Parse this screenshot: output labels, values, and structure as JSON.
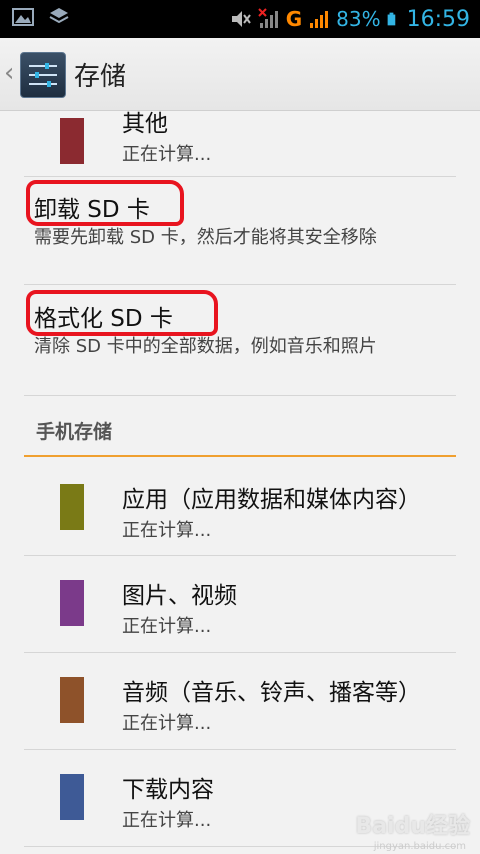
{
  "statusbar": {
    "network": "G",
    "battery": "83%",
    "time": "16:59"
  },
  "actionbar": {
    "title": "存储"
  },
  "sd_items": {
    "other": {
      "title": "其他",
      "status": "正在计算...",
      "color": "#8b2a30"
    },
    "unmount": {
      "title": "卸载 SD 卡",
      "desc": "需要先卸载 SD 卡，然后才能将其安全移除"
    },
    "format": {
      "title": "格式化 SD 卡",
      "desc": "清除 SD 卡中的全部数据，例如音乐和照片"
    }
  },
  "phone_storage": {
    "header": "手机存储",
    "items": [
      {
        "title": "应用（应用数据和媒体内容）",
        "status": "正在计算...",
        "color": "#7a7a16"
      },
      {
        "title": "图片、视频",
        "status": "正在计算...",
        "color": "#7b3a8a"
      },
      {
        "title": "音频（音乐、铃声、播客等）",
        "status": "正在计算...",
        "color": "#8e522a"
      },
      {
        "title": "下载内容",
        "status": "正在计算...",
        "color": "#3e5a96"
      }
    ]
  },
  "watermark": {
    "brand": "Baidu经验",
    "url": "jingyan.baidu.com"
  },
  "colors": {
    "accent": "#33b5e5",
    "section_rule": "#f0a030",
    "annotation": "#e8141f"
  }
}
